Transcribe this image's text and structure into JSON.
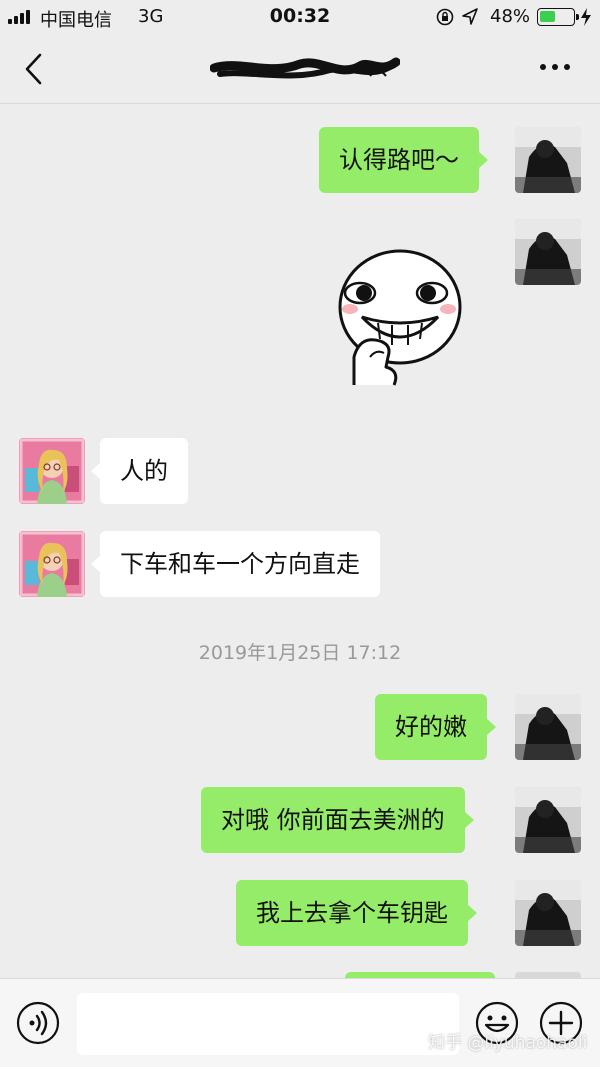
{
  "status_bar": {
    "carrier": "中国电信",
    "network": "3G",
    "time": "00:32",
    "battery_percent": "48%",
    "battery_level": 0.48,
    "icons": [
      "signal-icon",
      "orientation-lock-icon",
      "location-icon",
      "battery-icon",
      "charging-icon"
    ]
  },
  "nav": {
    "back_icon": "chevron-left-icon",
    "more_icon": "more-dots-icon",
    "title_obscured": true
  },
  "messages": [
    {
      "side": "out",
      "type": "text",
      "text": "认得路吧～"
    },
    {
      "side": "out",
      "type": "sticker",
      "sticker": "grinning-face-sticker"
    },
    {
      "side": "in",
      "type": "text",
      "text": "人的"
    },
    {
      "side": "in",
      "type": "text",
      "text": "下车和车一个方向直走"
    },
    {
      "type": "timestamp",
      "text": "2019年1月25日 17:12"
    },
    {
      "side": "out",
      "type": "text",
      "text": "好的嫩"
    },
    {
      "side": "out",
      "type": "text",
      "text": "对哦 你前面去美洲的"
    },
    {
      "side": "out",
      "type": "text",
      "text": "我上去拿个车钥匙"
    },
    {
      "side": "out",
      "type": "text",
      "text": ""
    }
  ],
  "input_bar": {
    "voice_icon": "voice-icon",
    "input_value": "",
    "emoji_icon": "emoji-icon",
    "plus_icon": "plus-icon"
  },
  "watermark": "知乎 @liyuhaohaoli",
  "colors": {
    "background": "#ededed",
    "outgoing_bubble": "#95ec69",
    "incoming_bubble": "#ffffff",
    "timestamp_text": "#999999",
    "battery_fill": "#3ccf4e"
  }
}
